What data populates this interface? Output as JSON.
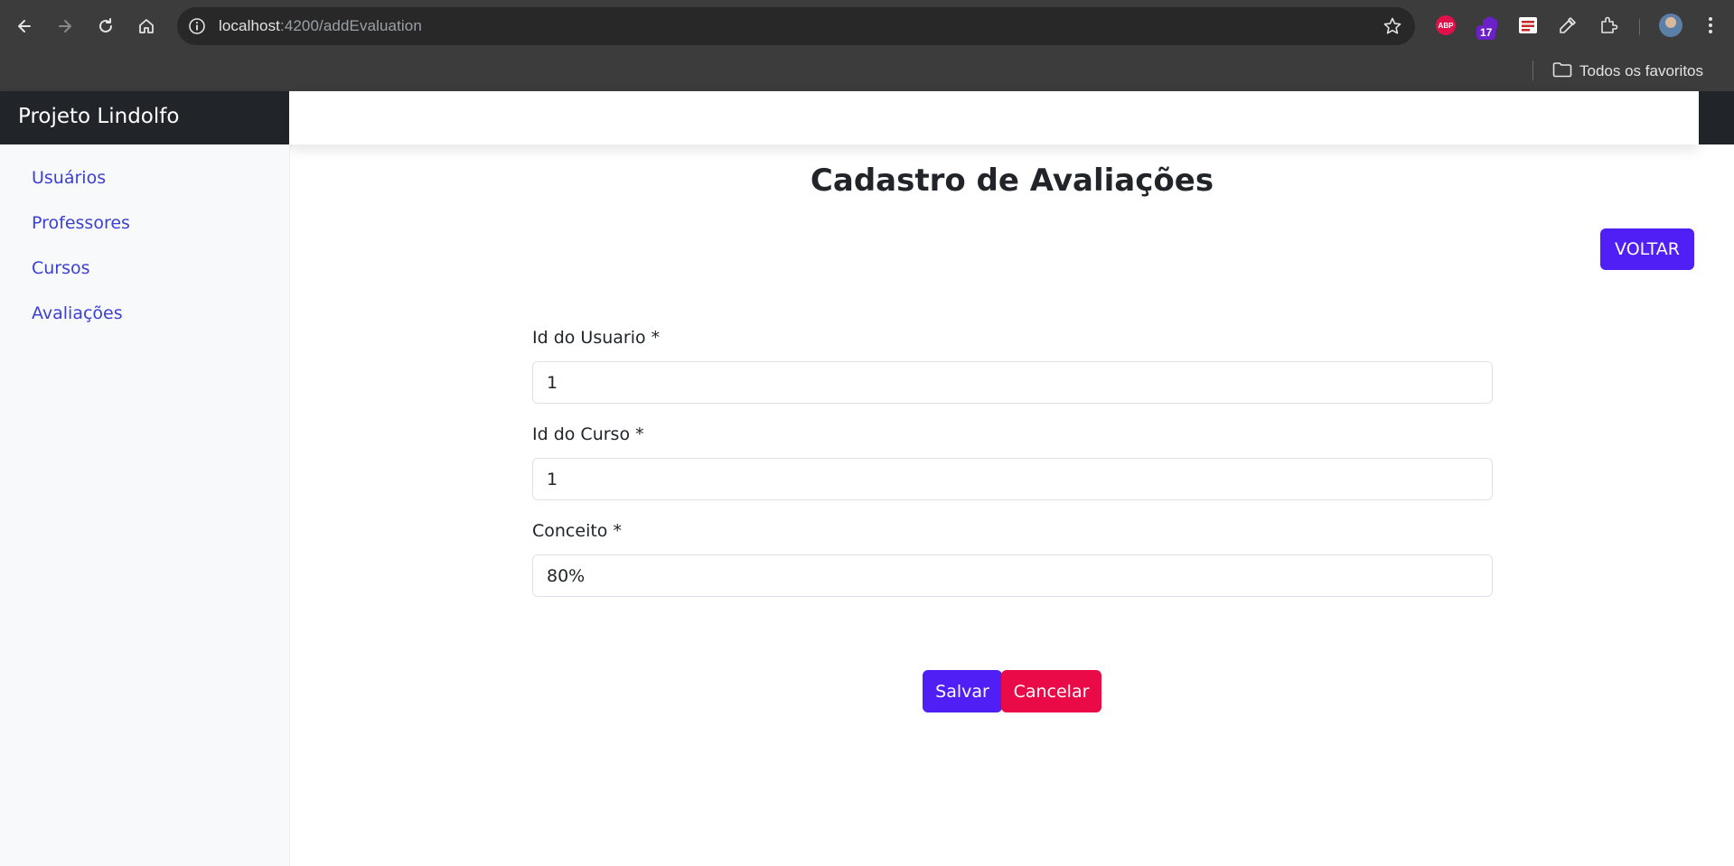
{
  "browser": {
    "url_host": "localhost",
    "url_rest": ":4200/addEvaluation",
    "extension_badge": "17",
    "abp_label": "ABP",
    "bookmarks_all": "Todos os favoritos",
    "icons": {
      "back": "arrow-left-icon",
      "forward": "arrow-right-icon",
      "reload": "reload-icon",
      "home": "home-icon",
      "site_info": "info-icon",
      "bookmark": "star-icon",
      "extensions": "puzzle-icon",
      "menu": "kebab-menu-icon",
      "folder": "folder-icon"
    }
  },
  "app": {
    "brand": "Projeto Lindolfo",
    "sidebar": {
      "items": [
        {
          "label": "Usuários"
        },
        {
          "label": "Professores"
        },
        {
          "label": "Cursos"
        },
        {
          "label": "Avaliações"
        }
      ]
    },
    "main": {
      "title": "Cadastro de Avaliações",
      "back_button": "VOLTAR",
      "form": {
        "user_id": {
          "label": "Id do Usuario *",
          "value": "1"
        },
        "course_id": {
          "label": "Id do Curso *",
          "value": "1"
        },
        "concept": {
          "label": "Conceito *",
          "value": "80%"
        }
      },
      "save_button": "Salvar",
      "cancel_button": "Cancelar"
    }
  },
  "colors": {
    "primary": "#4f1ff5",
    "danger": "#ea0a47",
    "link": "#3b3fd6",
    "dark": "#212529",
    "chrome": "#3c3c3c"
  }
}
